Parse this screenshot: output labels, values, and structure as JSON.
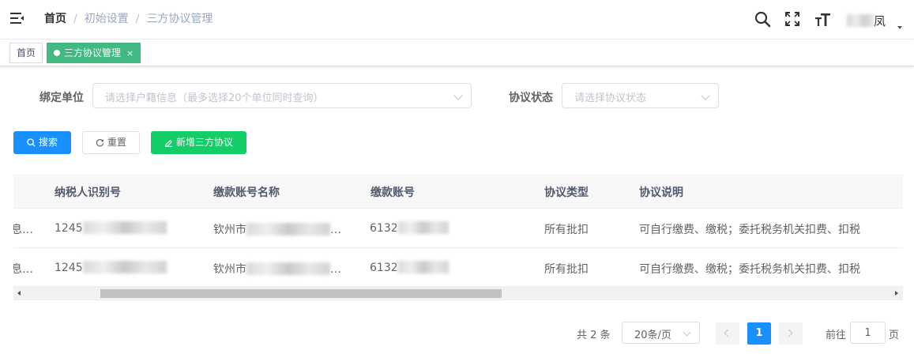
{
  "header": {
    "breadcrumb": [
      "首页",
      "初始设置",
      "三方协议管理"
    ],
    "separator": "/",
    "user_name_suffix": "凤"
  },
  "tags": [
    {
      "label": "首页",
      "active": false
    },
    {
      "label": "三方协议管理",
      "active": true,
      "close": "×"
    }
  ],
  "form": {
    "unit_label": "绑定单位",
    "unit_placeholder": "请选择户籍信息（最多选择20个单位同时查询）",
    "status_label": "协议状态",
    "status_placeholder": "请选择协议状态"
  },
  "buttons": {
    "search": "搜索",
    "reset": "重置",
    "add": "新增三方协议"
  },
  "table": {
    "columns": [
      "纳税人识别号",
      "缴款账号名称",
      "缴款账号",
      "协议类型",
      "协议说明"
    ],
    "rows": [
      {
        "cut": "息…",
        "tax_id": "1245",
        "account_name": "钦州市",
        "account_name_tail": "…",
        "account_no": "6132",
        "type": "所有批扣",
        "desc": "可自行缴费、缴税；委托税务机关扣费、扣税"
      },
      {
        "cut": "息…",
        "tax_id": "1245",
        "account_name": "钦州市",
        "account_name_tail": "…",
        "account_no": "6132",
        "type": "所有批扣",
        "desc": "可自行缴费、缴税；委托税务机关扣费、扣税"
      }
    ]
  },
  "pagination": {
    "total": "共 2 条",
    "page_size": "20条/页",
    "current": "1",
    "goto_label": "前往",
    "goto_value": "1",
    "goto_unit": "页"
  },
  "colors": {
    "primary": "#1890ff",
    "success": "#13ce66",
    "tag_active": "#42b983"
  }
}
